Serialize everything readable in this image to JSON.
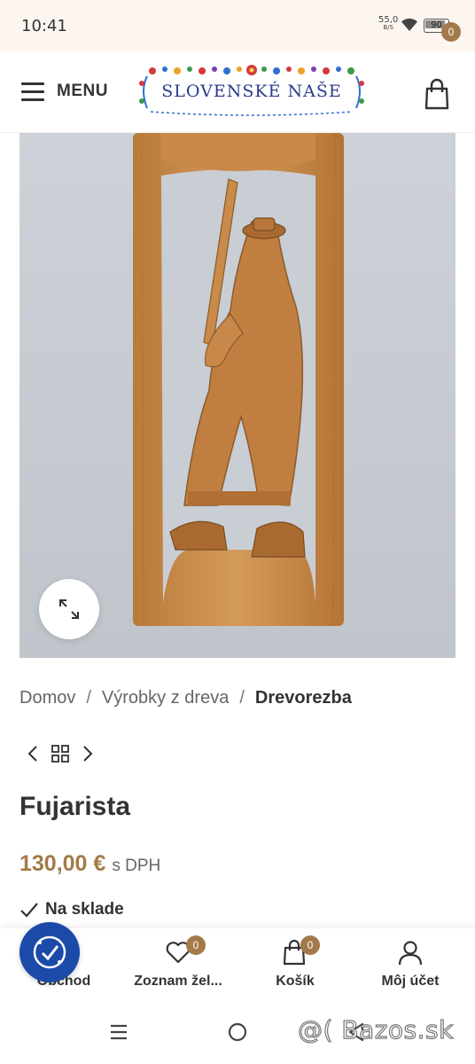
{
  "status_bar": {
    "time": "10:41",
    "net_speed": "55,0",
    "net_unit": "B/S",
    "battery": "90"
  },
  "header": {
    "menu_label": "MENU",
    "logo_text": "SLOVENSKÉ NAŠE",
    "cart_count": "0"
  },
  "breadcrumb": {
    "items": [
      "Domov",
      "Výrobky z dreva"
    ],
    "separator": "/",
    "current": "Drevorezba"
  },
  "product": {
    "title": "Fujarista",
    "price": "130,00 €",
    "price_suffix": "s DPH",
    "stock": "Na sklade"
  },
  "toolbar": {
    "items": [
      {
        "label": "Obchod",
        "icon": "shop-icon"
      },
      {
        "label": "Zoznam žel...",
        "icon": "heart-icon",
        "badge": "0"
      },
      {
        "label": "Košík",
        "icon": "cart-icon",
        "badge": "0"
      },
      {
        "label": "Môj účet",
        "icon": "user-icon"
      }
    ]
  },
  "watermark": "@( Bazos.sk",
  "colors": {
    "accent": "#a47a4a",
    "accessibility_blue": "#1c4aa8",
    "status_bar_bg": "#fdf5ef"
  }
}
